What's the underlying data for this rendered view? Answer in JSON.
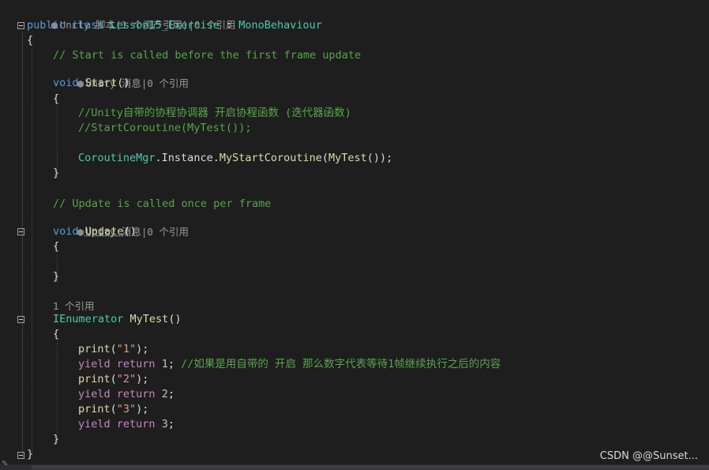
{
  "editor": {
    "class_codelens": "Unity 脚本(1 个资产引用)|0 个引用",
    "class_decl": {
      "kw_public": "public",
      "kw_class": "class",
      "class_name": "Lesson15_Exercise",
      "colon": " : ",
      "base": "MonoBehaviour"
    },
    "open_brace": "{",
    "close_brace": "}",
    "start_comment": "// Start is called before the first frame update",
    "start_codelens": "Unity 消息|0 个引用",
    "start_decl": {
      "kw_void": "void",
      "name": "Start",
      "parens": "()"
    },
    "start_body": {
      "comment1": "//Unity自带的协程协调器 开启协程函数 (迭代器函数)",
      "comment2": "//StartCoroutine(MyTest());",
      "call_type": "CoroutineMgr",
      "call_mid": ".Instance.",
      "call_fn": "MyStartCoroutine",
      "call_open": "(",
      "call_arg": "MyTest",
      "call_close": "());"
    },
    "update_comment": "// Update is called once per frame",
    "update_codelens": "Unity 消息|0 个引用",
    "update_decl": {
      "kw_void": "void",
      "name": "Update",
      "parens": "()"
    },
    "mytest_codelens": "1 个引用",
    "mytest_decl": {
      "type": "IEnumerator",
      "name": "MyTest",
      "parens": "()"
    },
    "mytest_body": [
      {
        "kind": "print",
        "fn": "print",
        "open": "(",
        "str": "\"1\"",
        "close": ");"
      },
      {
        "kind": "yield",
        "kw1": "yield",
        "kw2": "return",
        "num": "1",
        "semi": ";",
        "comment": "//如果是用自带的 开启 那么数字代表等待1帧继续执行之后的内容"
      },
      {
        "kind": "print",
        "fn": "print",
        "open": "(",
        "str": "\"2\"",
        "close": ");"
      },
      {
        "kind": "yield",
        "kw1": "yield",
        "kw2": "return",
        "num": "2",
        "semi": ";",
        "comment": ""
      },
      {
        "kind": "print",
        "fn": "print",
        "open": "(",
        "str": "\"3\"",
        "close": ");"
      },
      {
        "kind": "yield",
        "kw1": "yield",
        "kw2": "return",
        "num": "3",
        "semi": ";",
        "comment": ""
      }
    ]
  },
  "watermark": "CSDN @@Sunset...",
  "colors": {
    "background": "#1e1e1e",
    "keyword": "#569cd6",
    "control_keyword": "#c586c0",
    "type": "#4ec9b0",
    "function": "#dcdcaa",
    "string": "#d69d85",
    "number": "#b5cea8",
    "comment": "#57a64a",
    "text": "#dcdcdc"
  },
  "icons": {
    "codelens": "unity-cube-icon",
    "fold": "collapse-minus-icon"
  }
}
